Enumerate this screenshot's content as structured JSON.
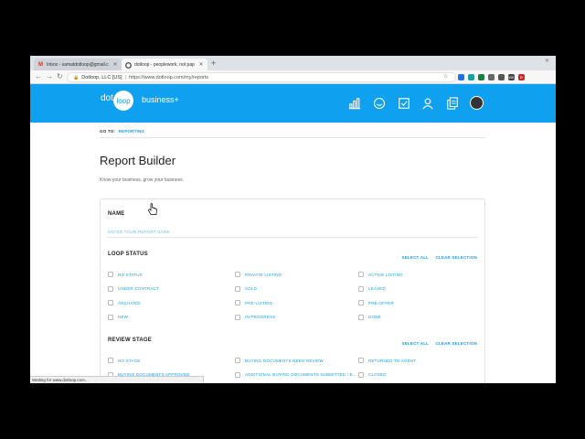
{
  "browser": {
    "tabs": [
      {
        "title": "Inbox - samatdotloop@gmail.c",
        "active": false
      },
      {
        "title": "dotloop - peoplework, not pap",
        "active": true
      }
    ],
    "address": {
      "site": "Dotloop, LLC [US]",
      "separator": "|",
      "url": "https://www.dotloop.com/my/reports"
    },
    "extensions": [
      {
        "icon": "ext-blue",
        "color": "#1a73e8"
      },
      {
        "icon": "ext-teal",
        "color": "#1aa0a0"
      },
      {
        "icon": "ext-green",
        "color": "#188038"
      },
      {
        "icon": "ext-gray",
        "color": "#666666"
      },
      {
        "icon": "ext-bookmark",
        "color": "#555555"
      },
      {
        "icon": "ext-wk",
        "color": "#444444",
        "label": "WK"
      },
      {
        "icon": "ext-r",
        "color": "#c62828",
        "label": "R"
      }
    ],
    "status_text": "Waiting for www.dotloop.com..."
  },
  "header": {
    "logo_left": "dot",
    "logo_circle": "loop",
    "logo_right": "business+",
    "accent": "#0fa0ef"
  },
  "page": {
    "goto_label": "GO TO:",
    "goto_link": "REPORTING",
    "title": "Report Builder",
    "subtitle": "Know your business, grow your business."
  },
  "form": {
    "name_label": "NAME",
    "name_placeholder": "ENTER YOUR REPORT NAME",
    "select_all": "SELECT ALL",
    "clear_selection": "CLEAR SELECTION",
    "loop_status": {
      "label": "LOOP STATUS",
      "options": [
        "NO STATUS",
        "PRIVATE LISTING",
        "ACTIVE LISTING",
        "UNDER CONTRACT",
        "SOLD",
        "LEASED",
        "ARCHIVED",
        "PRE-LISTING",
        "PRE-OFFER",
        "NEW",
        "IN PROGRESS",
        "DONE"
      ]
    },
    "review_stage": {
      "label": "REVIEW STAGE",
      "options": [
        "NO STAGE",
        "BUYING DOCUMENTS NEED REVIEW",
        "RETURNED TO AGENT",
        "BUYING DOCUMENTS APPROVED",
        "ADDITIONAL BUYING DOCUMENTS SUBMITTED / E...",
        "CLOSED"
      ]
    }
  }
}
